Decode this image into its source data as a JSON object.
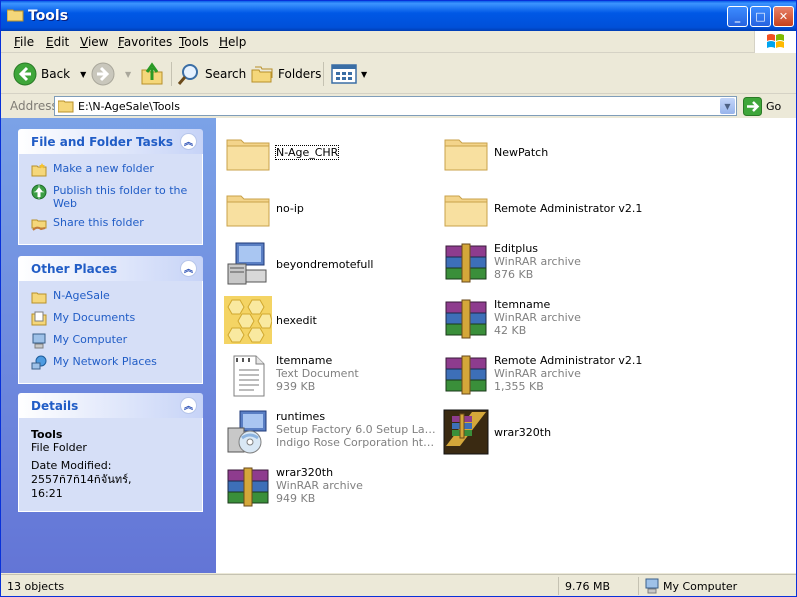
{
  "window": {
    "title": "Tools",
    "minimize": "_",
    "maximize": "□",
    "close": "✕"
  },
  "menu": [
    "File",
    "Edit",
    "View",
    "Favorites",
    "Tools",
    "Help"
  ],
  "toolbar": {
    "back": "Back",
    "search": "Search",
    "folders": "Folders"
  },
  "address": {
    "label": "Address",
    "path": "E:\\N-AgeSale\\Tools",
    "go": "Go"
  },
  "panels": {
    "tasks": {
      "title": "File and Folder Tasks",
      "items": [
        "Make a new folder",
        "Publish this folder to the Web",
        "Share this folder"
      ]
    },
    "places": {
      "title": "Other Places",
      "items": [
        "N-AgeSale",
        "My Documents",
        "My Computer",
        "My Network Places"
      ]
    },
    "details": {
      "title": "Details",
      "name": "Tools",
      "type": "File Folder",
      "date_label": "Date Modified: 2557ñ7ñ14ñจันทร์,",
      "date_time": "16:21"
    }
  },
  "items": [
    {
      "name": "N-Age_CHR",
      "icon": "folder-icon"
    },
    {
      "name": "NewPatch",
      "icon": "folder-icon"
    },
    {
      "name": "no-ip",
      "icon": "folder-icon"
    },
    {
      "name": "Remote Administrator v2.1",
      "icon": "folder-icon"
    },
    {
      "name": "beyondremotefull",
      "icon": "setup-computer-icon"
    },
    {
      "name": "Editplus",
      "type": "WinRAR archive",
      "size": "876 KB",
      "icon": "winrar-archive-icon"
    },
    {
      "name": "hexedit",
      "icon": "hexedit-icon"
    },
    {
      "name": "Itemname",
      "type": "WinRAR archive",
      "size": "42 KB",
      "icon": "winrar-archive-icon"
    },
    {
      "name": "Itemname",
      "type": "Text Document",
      "size": "939 KB",
      "icon": "text-document-icon"
    },
    {
      "name": "Remote Administrator v2.1",
      "type": "WinRAR archive",
      "size": "1,355 KB",
      "icon": "winrar-archive-icon"
    },
    {
      "name": "runtimes",
      "type": "Setup Factory 6.0 Setup Laun...",
      "size": "Indigo Rose Corporation http:...",
      "icon": "setup-cd-icon"
    },
    {
      "name": "wrar320th",
      "icon": "winrar-installer-icon"
    },
    {
      "name": "wrar320th",
      "type": "WinRAR archive",
      "size": "949 KB",
      "icon": "winrar-archive-icon"
    }
  ],
  "status": {
    "count": "13 objects",
    "size": "9.76 MB",
    "location": "My Computer"
  }
}
